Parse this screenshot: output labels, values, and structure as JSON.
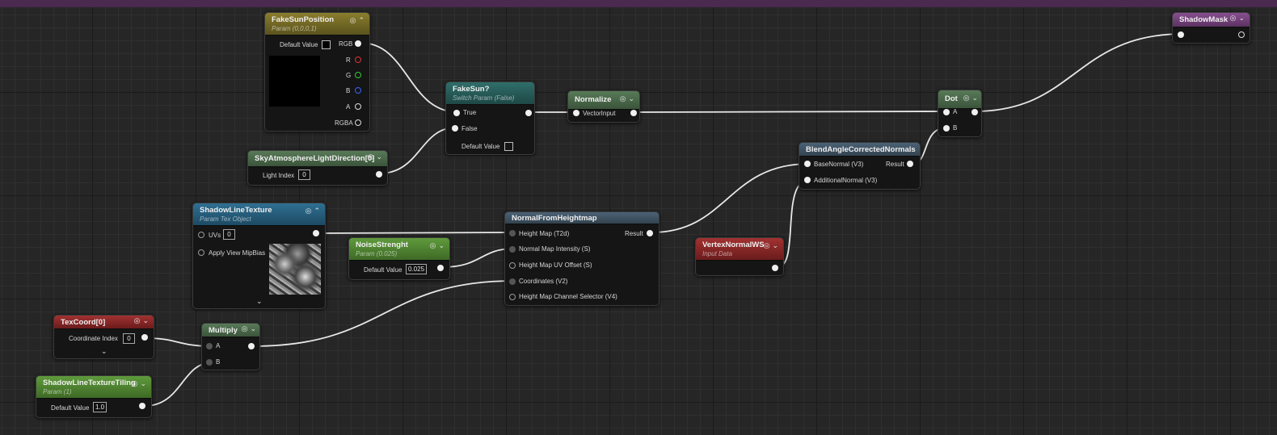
{
  "nodes": {
    "fake_sun_position": {
      "title": "FakeSunPosition",
      "subtitle": "Param (0,0,0,1)",
      "default_value_label": "Default Value",
      "pins": [
        "RGB",
        "R",
        "G",
        "B",
        "A",
        "RGBA"
      ]
    },
    "fake_sun": {
      "title": "FakeSun?",
      "subtitle": "Switch Param (False)",
      "pin_true": "True",
      "pin_false": "False",
      "default_value_label": "Default Value"
    },
    "normalize": {
      "title": "Normalize",
      "pin_input": "VectorInput"
    },
    "dot": {
      "title": "Dot",
      "pin_a": "A",
      "pin_b": "B"
    },
    "shadow_mask": {
      "title": "ShadowMask"
    },
    "sky_atmosphere": {
      "title": "SkyAtmosphereLightDirection[0]",
      "light_index_label": "Light Index",
      "light_index_value": "0"
    },
    "blend_angle": {
      "title": "BlendAngleCorrectedNormals",
      "pin_base": "BaseNormal (V3)",
      "pin_additional": "AdditionalNormal (V3)",
      "pin_result": "Result"
    },
    "shadow_line_texture": {
      "title": "ShadowLineTexture",
      "subtitle": "Param Tex Object",
      "uvs_label": "UVs",
      "uvs_value": "0",
      "apply_mip_label": "Apply View MipBias"
    },
    "noise_strenght": {
      "title": "NoiseStrenght",
      "subtitle": "Param (0.025)",
      "default_value_label": "Default Value",
      "default_value": "0.025"
    },
    "normal_from_heightmap": {
      "title": "NormalFromHeightmap",
      "pin_height": "Height Map (T2d)",
      "pin_intensity": "Normal Map Intensity (S)",
      "pin_uv_offset": "Height Map UV Offset (S)",
      "pin_coords": "Coordinates (V2)",
      "pin_channel": "Height Map Channel Selector (V4)",
      "pin_result": "Result"
    },
    "vertex_normal": {
      "title": "VertexNormalWS",
      "subtitle": "Input Data"
    },
    "tex_coord": {
      "title": "TexCoord[0]",
      "coord_index_label": "Coordinate Index",
      "coord_index_value": "0"
    },
    "multiply": {
      "title": "Multiply",
      "pin_a": "A",
      "pin_b": "B"
    },
    "tiling": {
      "title": "ShadowLineTextureTiling",
      "subtitle": "Param (1)",
      "default_value_label": "Default Value",
      "default_value": "1.0"
    }
  },
  "icons": {
    "preview": "preview-toggle-icon",
    "collapse": "collapse-chevron-icon",
    "expand": "expand-chevron-icon"
  }
}
